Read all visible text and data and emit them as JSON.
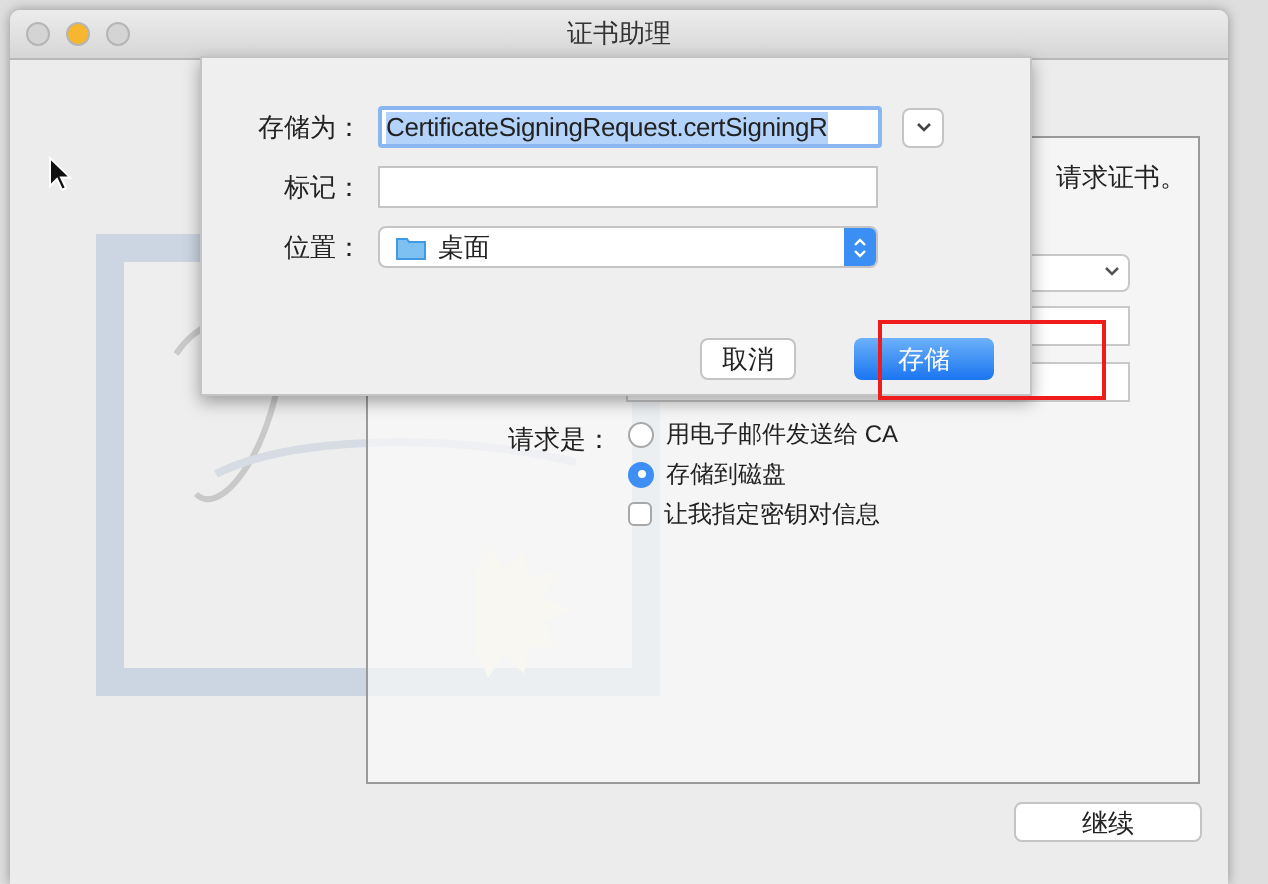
{
  "window": {
    "title": "证书助理"
  },
  "traffic_lights": [
    {
      "color": "#d4d4d4"
    },
    {
      "color": "#f6b72e"
    },
    {
      "color": "#d4d4d4"
    }
  ],
  "assistant": {
    "intro_fragment": "请求证书。",
    "request_label": "请求是：",
    "request_options": [
      {
        "kind": "radio",
        "label": "用电子邮件发送给 CA",
        "selected": false
      },
      {
        "kind": "radio",
        "label": "存储到磁盘",
        "selected": true
      },
      {
        "kind": "checkbox",
        "label": "让我指定密钥对信息",
        "checked": false
      }
    ],
    "continue_button": "继续"
  },
  "save_sheet": {
    "save_as_label": "存储为：",
    "filename": "CertificateSigningRequest.certSigningR",
    "tags_label": "标记：",
    "location_label": "位置：",
    "location": "桌面",
    "buttons": [
      {
        "label": "取消",
        "default": false
      },
      {
        "label": "存储",
        "default": true
      }
    ]
  }
}
